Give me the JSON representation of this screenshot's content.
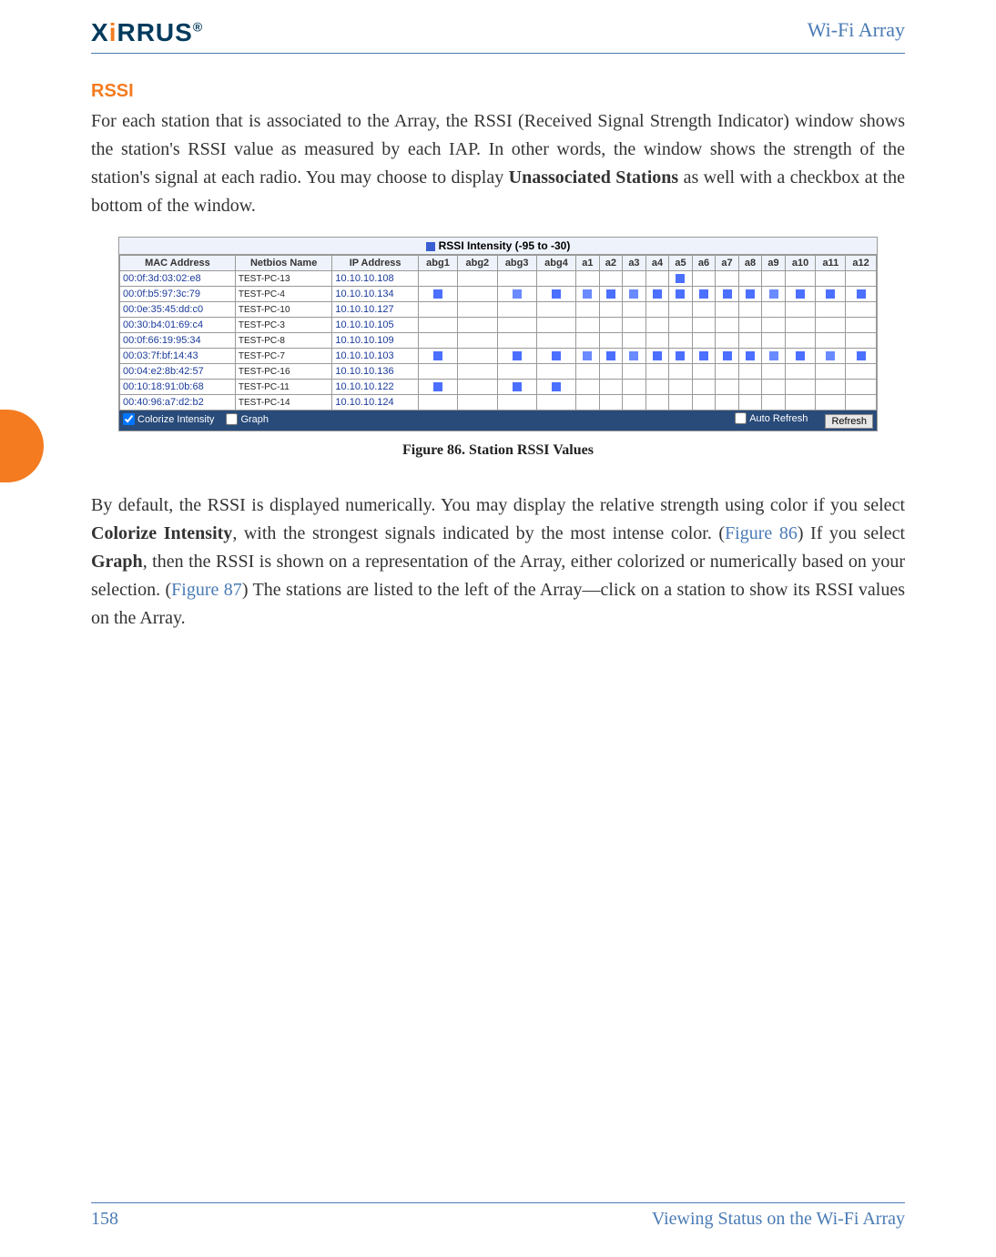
{
  "header": {
    "logo_text": "XIRRUS",
    "product": "Wi-Fi Array"
  },
  "section": {
    "heading": "RSSI",
    "para1_a": "For each station that is associated to the Array, the RSSI (Received Signal Strength Indicator) window shows the station's RSSI value as measured by each IAP. In other words, the window shows the strength of the station's signal at each radio. You may choose to display ",
    "para1_bold": "Unassociated Stations",
    "para1_b": " as well with a checkbox at the bottom of the window.",
    "caption": "Figure 86. Station RSSI Values",
    "para2_a": "By default, the RSSI is displayed numerically. You may display the  relative strength using color if you select ",
    "para2_bold1": "Colorize Intensity",
    "para2_b": ", with the strongest signals indicated by the most intense color. (",
    "para2_link1": "Figure 86",
    "para2_c": ") If you select ",
    "para2_bold2": "Graph",
    "para2_d": ", then the RSSI is shown on a representation of the Array, either colorized or numerically based on your selection. (",
    "para2_link2": "Figure 87",
    "para2_e": ") The stations are listed to the left of the Array—click on a station to show its RSSI values on the Array."
  },
  "screenshot": {
    "legend": "RSSI Intensity (-95 to -30)",
    "headers": [
      "MAC Address",
      "Netbios Name",
      "IP Address",
      "abg1",
      "abg2",
      "abg3",
      "abg4",
      "a1",
      "a2",
      "a3",
      "a4",
      "a5",
      "a6",
      "a7",
      "a8",
      "a9",
      "a10",
      "a11",
      "a12"
    ],
    "rows": [
      {
        "mac": "00:0f:3d:03:02:e8",
        "nb": "TEST-PC-13",
        "ip": "10.10.10.108",
        "cells": [
          "",
          "",
          "",
          "",
          "",
          "",
          "",
          "",
          "1",
          "",
          "",
          "",
          "",
          "",
          "",
          ""
        ]
      },
      {
        "mac": "00:0f:b5:97:3c:79",
        "nb": "TEST-PC-4",
        "ip": "10.10.10.134",
        "cells": [
          "1",
          "",
          "2",
          "1",
          "2",
          "1",
          "2",
          "1",
          "1",
          "1",
          "1",
          "1",
          "2",
          "1",
          "1",
          "1"
        ]
      },
      {
        "mac": "00:0e:35:45:dd:c0",
        "nb": "TEST-PC-10",
        "ip": "10.10.10.127",
        "cells": [
          "",
          "",
          "",
          "",
          "",
          "",
          "",
          "",
          "",
          "",
          "",
          "",
          "",
          "",
          "",
          ""
        ]
      },
      {
        "mac": "00:30:b4:01:69:c4",
        "nb": "TEST-PC-3",
        "ip": "10.10.10.105",
        "cells": [
          "",
          "",
          "",
          "",
          "",
          "",
          "",
          "",
          "",
          "",
          "",
          "",
          "",
          "",
          "",
          ""
        ]
      },
      {
        "mac": "00:0f:66:19:95:34",
        "nb": "TEST-PC-8",
        "ip": "10.10.10.109",
        "cells": [
          "",
          "",
          "",
          "",
          "",
          "",
          "",
          "",
          "",
          "",
          "",
          "",
          "",
          "",
          "",
          ""
        ]
      },
      {
        "mac": "00:03:7f:bf:14:43",
        "nb": "TEST-PC-7",
        "ip": "10.10.10.103",
        "cells": [
          "1",
          "",
          "1",
          "1",
          "2",
          "1",
          "2",
          "1",
          "1",
          "1",
          "1",
          "1",
          "2",
          "1",
          "2",
          "1"
        ]
      },
      {
        "mac": "00:04:e2:8b:42:57",
        "nb": "TEST-PC-16",
        "ip": "10.10.10.136",
        "cells": [
          "",
          "",
          "",
          "",
          "",
          "",
          "",
          "",
          "",
          "",
          "",
          "",
          "",
          "",
          "",
          ""
        ]
      },
      {
        "mac": "00:10:18:91:0b:68",
        "nb": "TEST-PC-11",
        "ip": "10.10.10.122",
        "cells": [
          "1",
          "",
          "1",
          "1",
          "",
          "",
          "",
          "",
          "",
          "",
          "",
          "",
          "",
          "",
          "",
          ""
        ]
      },
      {
        "mac": "00:40:96:a7:d2:b2",
        "nb": "TEST-PC-14",
        "ip": "10.10.10.124",
        "cells": [
          "",
          "",
          "",
          "",
          "",
          "",
          "",
          "",
          "",
          "",
          "",
          "",
          "",
          "",
          "",
          ""
        ]
      }
    ],
    "footer": {
      "colorize": "Colorize Intensity",
      "graph": "Graph",
      "auto_refresh": "Auto Refresh",
      "refresh": "Refresh"
    }
  },
  "footer": {
    "page": "158",
    "section": "Viewing Status on the Wi-Fi Array"
  }
}
